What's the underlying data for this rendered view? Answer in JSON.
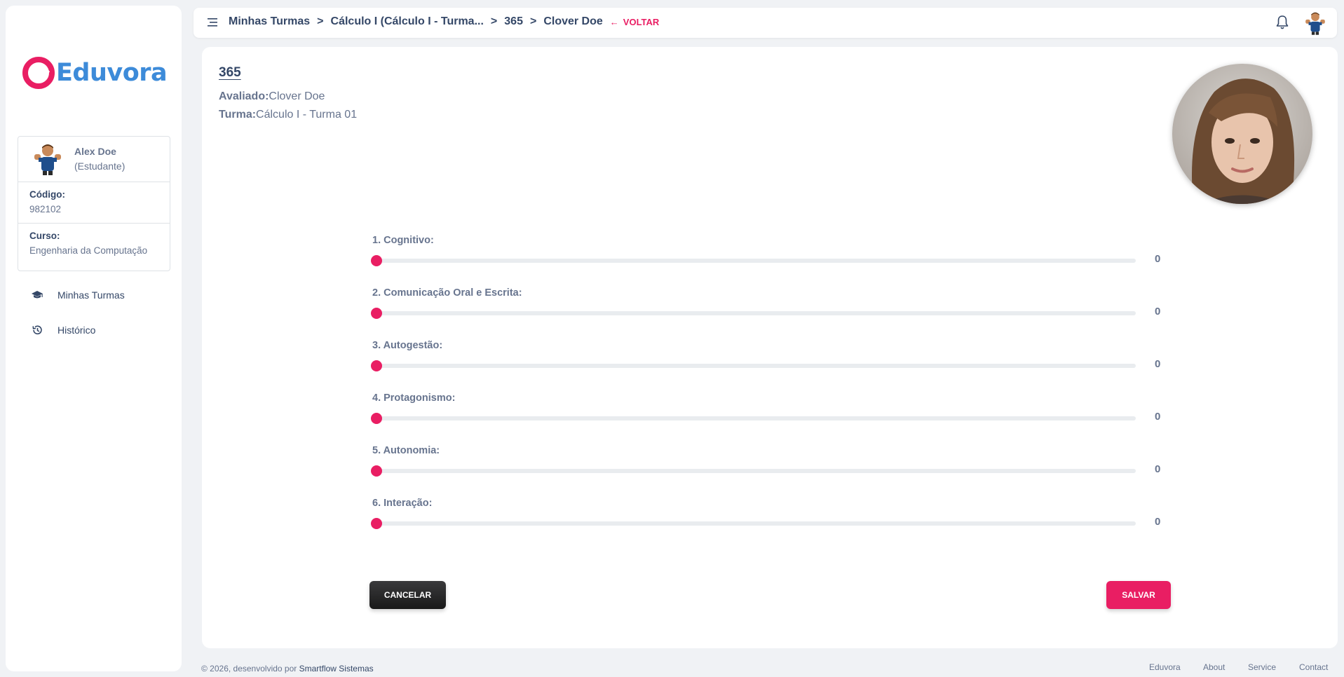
{
  "sidebar": {
    "logo_text": "Eduvora",
    "user": {
      "name": "Alex Doe",
      "role": "(Estudante)",
      "code_label": "Código:",
      "code_value": "982102",
      "course_label": "Curso:",
      "course_value": "Engenharia da Computação"
    },
    "nav": [
      {
        "label": "Minhas Turmas",
        "icon": "graduation-cap-icon"
      },
      {
        "label": "Histórico",
        "icon": "history-icon"
      }
    ]
  },
  "topbar": {
    "breadcrumb": [
      "Minhas Turmas",
      "Cálculo I (Cálculo I - Turma...",
      "365",
      "Clover Doe"
    ],
    "separator": ">",
    "back_label": "VOLTAR",
    "back_arrow": "←"
  },
  "evaluation": {
    "title": "365",
    "evaluated_label": "Avaliado:",
    "evaluated_value": "Clover Doe",
    "class_label": "Turma:",
    "class_value": "Cálculo I - Turma 01",
    "criteria": [
      {
        "label": "1. Cognitivo:",
        "value": "0"
      },
      {
        "label": "2. Comunicação Oral e Escrita:",
        "value": "0"
      },
      {
        "label": "3. Autogestão:",
        "value": "0"
      },
      {
        "label": "4. Protagonismo:",
        "value": "0"
      },
      {
        "label": "5. Autonomia:",
        "value": "0"
      },
      {
        "label": "6. Interação:",
        "value": "0"
      }
    ],
    "cancel_label": "CANCELAR",
    "save_label": "SALVAR"
  },
  "footer": {
    "copyright": "© 2026, desenvolvido por ",
    "company": "Smartflow Sistemas",
    "links": [
      "Eduvora",
      "About",
      "Service",
      "Contact"
    ]
  },
  "colors": {
    "accent": "#e91e63",
    "brand_blue": "#3d8bd9",
    "text_dark": "#344767",
    "text_muted": "#67748e"
  }
}
